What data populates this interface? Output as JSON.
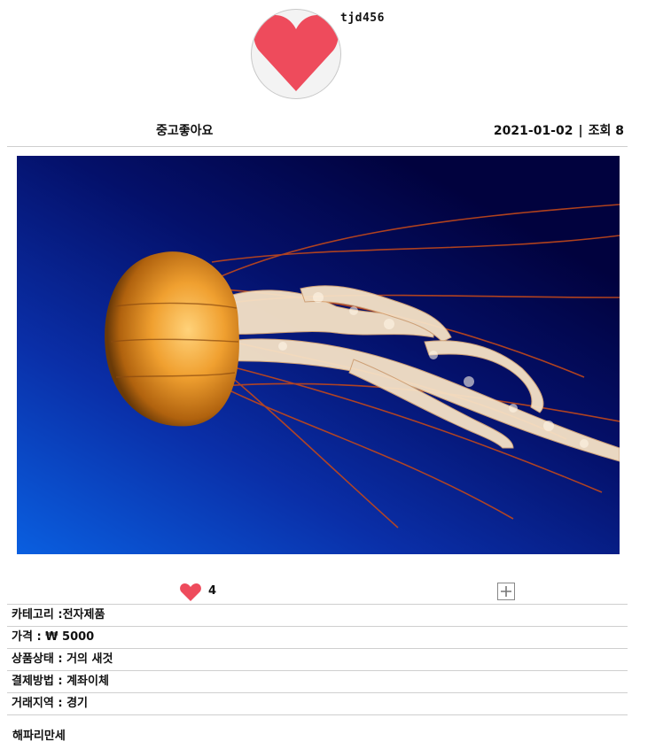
{
  "profile": {
    "username": "tjd456",
    "avatar_icon": "heart-icon",
    "avatar_color": "#ee4b5c"
  },
  "post": {
    "title": "중고좋아요",
    "date": "2021-01-02",
    "separator": "|",
    "views_label": "조회",
    "views": "8"
  },
  "image": {
    "subject": "jellyfish"
  },
  "actions": {
    "like_icon": "heart-icon",
    "like_color": "#ee4b5c",
    "like_count": "4",
    "add_icon": "plus-icon"
  },
  "details": [
    {
      "text": "카테고리 :전자제품"
    },
    {
      "text": "가격 : ₩ 5000"
    },
    {
      "text": "상품상태 : 거의 새것"
    },
    {
      "text": "결제방법 : 계좌이체"
    },
    {
      "text": "거래지역 : 경기"
    }
  ],
  "description": "해파리만세"
}
